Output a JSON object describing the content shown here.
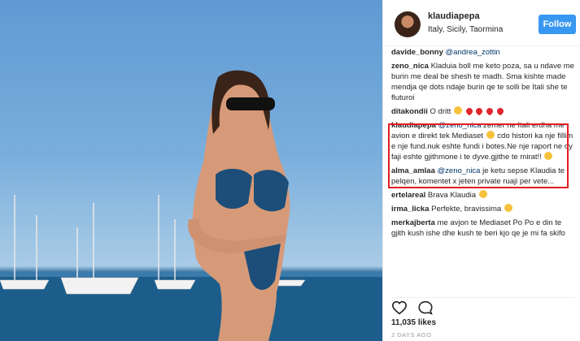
{
  "post": {
    "likes": "11,035 likes",
    "time": "2 DAYS AGO"
  },
  "header": {
    "username": "klaudiapepa",
    "location": "Italy, Sicily, Taormina",
    "follow_label": "Follow"
  },
  "comments": [
    {
      "user": "davide_bonny",
      "mention": "@andrea_zottin",
      "text": ""
    },
    {
      "user": "zeno_nica",
      "mention": "",
      "text": "Kladuia boll me keto poza, sa u ndave me burin me deal be shesh te madh. Sma kishte made mendja qe dots ndaje burin qe te solli be Itali she te fluturoi"
    },
    {
      "user": "ditakondii",
      "mention": "",
      "text": "O dritt"
    },
    {
      "user": "klaudiapepa",
      "mention": "@zeno_nica",
      "text": "zemer ne Itali erdha me avion e direkt tek Mediaset",
      "text2": "cdo histori ka nje fillim e nje fund.nuk eshte fundi i botes.Ne nje raport ne dy faji eshte gjithmone i te dyve.gjithe te mirat!!"
    },
    {
      "user": "alma_amlaa",
      "mention": "@zeno_nica",
      "text": "je ketu sepse Klaudia te pelqen, komentet x jeten private ruaji per vete..."
    },
    {
      "user": "ertelareal",
      "mention": "",
      "text": "Brava Klaudia"
    },
    {
      "user": "irma_licka",
      "mention": "",
      "text": "Perfekte, bravissima"
    },
    {
      "user": "merkajberta",
      "mention": "",
      "text": "me avjon te Mediaset Po Po e din te gjith kush ishe dhe kush te beri kjo qe je mi fa skifo"
    }
  ],
  "icons": [
    "heart-icon",
    "comment-icon"
  ]
}
